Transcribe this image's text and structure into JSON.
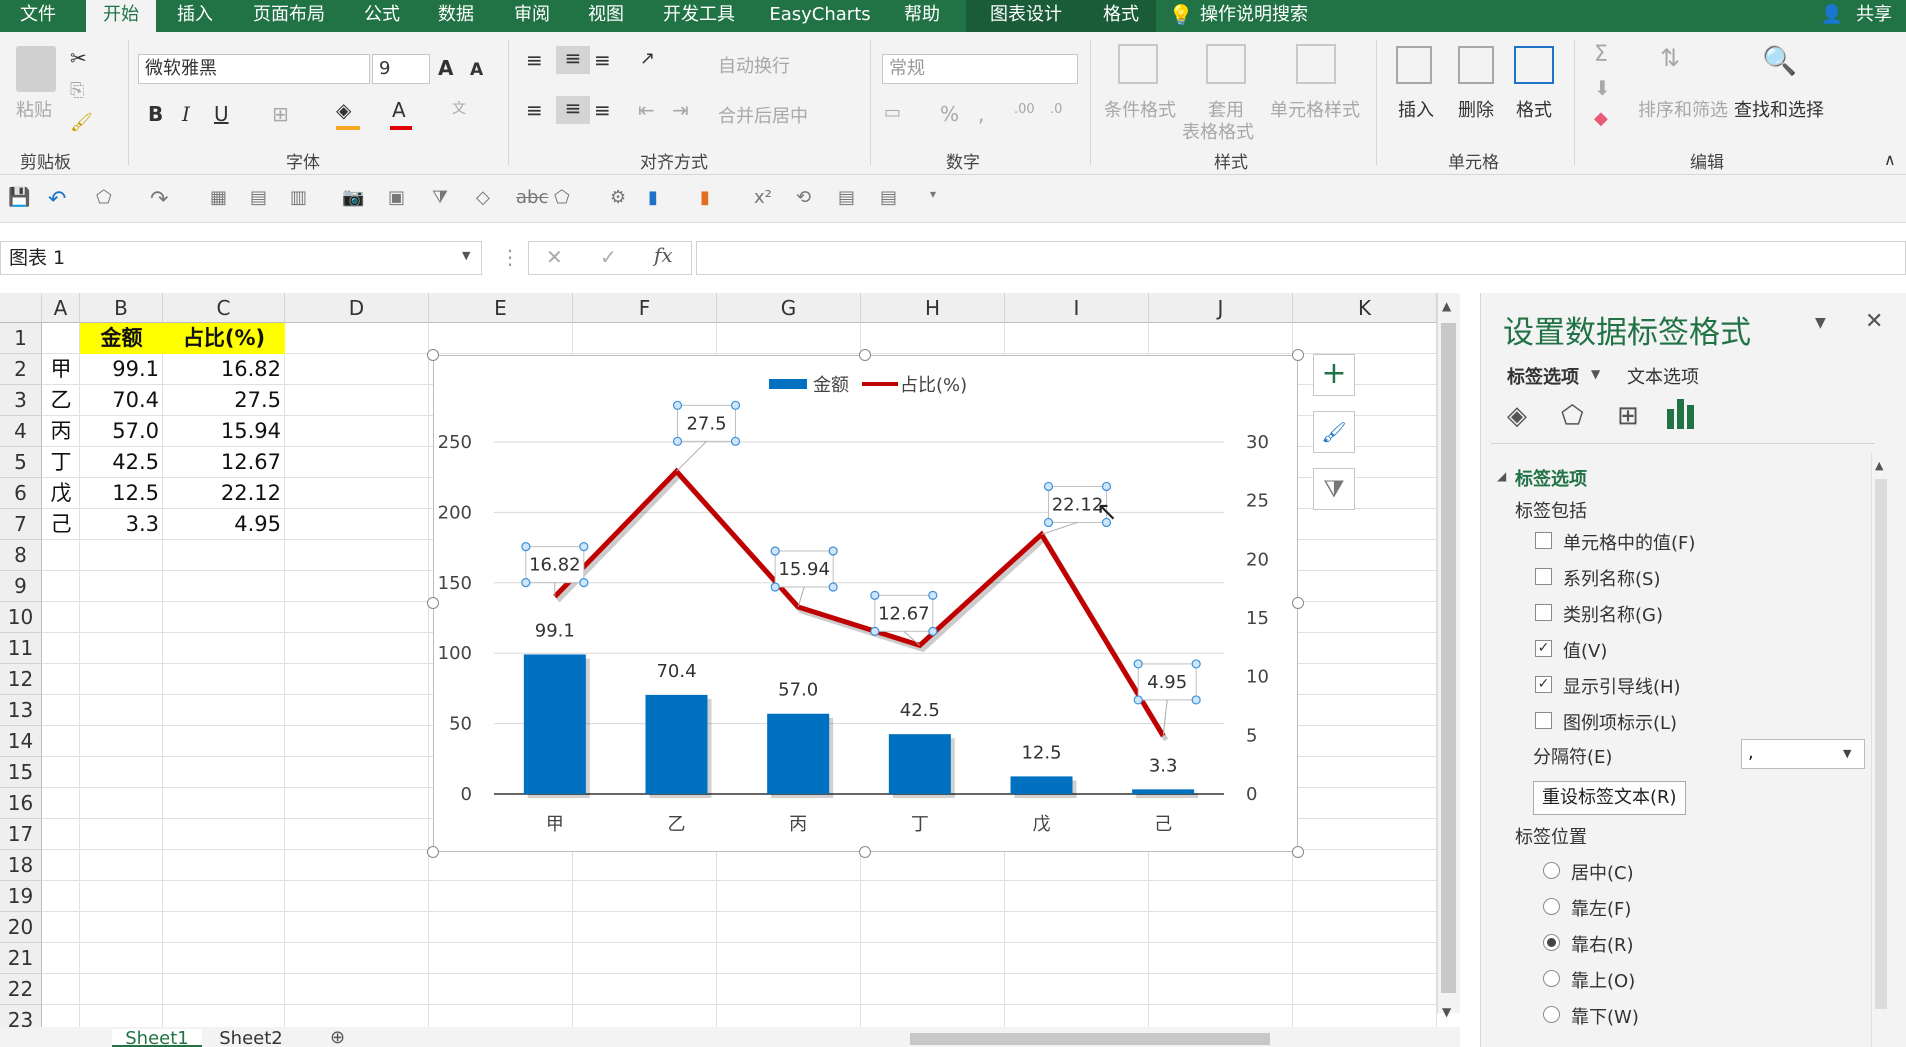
{
  "tabs": [
    "文件",
    "开始",
    "插入",
    "页面布局",
    "公式",
    "数据",
    "审阅",
    "视图",
    "开发工具",
    "EasyCharts",
    "帮助",
    "图表设计",
    "格式"
  ],
  "tell_me": "操作说明搜索",
  "share": "共享",
  "ribbon": {
    "paste": "粘贴",
    "font_name": "微软雅黑",
    "font_size": "9",
    "wrap_text": "自动换行",
    "merge_center": "合并后居中",
    "number_format": "常规",
    "cond_format": "条件格式",
    "table_format_1": "套用",
    "table_format_2": "表格格式",
    "cell_style": "单元格样式",
    "insert": "插入",
    "delete": "删除",
    "format": "格式",
    "sort_filter": "排序和筛选",
    "find_select": "查找和选择",
    "groups": [
      "剪贴板",
      "字体",
      "对齐方式",
      "数字",
      "样式",
      "单元格",
      "编辑"
    ]
  },
  "name_box": "图表 1",
  "columns": [
    "A",
    "B",
    "C",
    "D",
    "E",
    "F",
    "G",
    "H",
    "I",
    "J",
    "K"
  ],
  "rows": [
    "1",
    "2",
    "3",
    "4",
    "5",
    "6",
    "7",
    "8",
    "9",
    "10",
    "11",
    "12",
    "13",
    "14",
    "15",
    "16",
    "17",
    "18",
    "19",
    "20",
    "21",
    "22",
    "23"
  ],
  "table": {
    "header": [
      "",
      "金额",
      "占比(%)"
    ],
    "body": [
      [
        "甲",
        "99.1",
        "16.82"
      ],
      [
        "乙",
        "70.4",
        "27.5"
      ],
      [
        "丙",
        "57.0",
        "15.94"
      ],
      [
        "丁",
        "42.5",
        "12.67"
      ],
      [
        "戊",
        "12.5",
        "22.12"
      ],
      [
        "己",
        "3.3",
        "4.95"
      ]
    ]
  },
  "chart_data": {
    "type": "bar",
    "categories": [
      "甲",
      "乙",
      "丙",
      "丁",
      "戊",
      "己"
    ],
    "series": [
      {
        "name": "金额",
        "type": "bar",
        "values": [
          99.1,
          70.4,
          57.0,
          42.5,
          12.5,
          3.3
        ],
        "labels": [
          "99.1",
          "70.4",
          "57.0",
          "42.5",
          "12.5",
          "3.3"
        ],
        "color": "#0070c0",
        "axis": "left"
      },
      {
        "name": "占比(%)",
        "type": "line",
        "values": [
          16.82,
          27.5,
          15.94,
          12.67,
          22.12,
          4.95
        ],
        "labels": [
          "16.82",
          "27.5",
          "15.94",
          "12.67",
          "22.12",
          "4.95"
        ],
        "color": "#c00000",
        "axis": "right"
      }
    ],
    "y_left_ticks": [
      "0",
      "50",
      "100",
      "150",
      "200",
      "250"
    ],
    "y_right_ticks": [
      "0",
      "5",
      "10",
      "15",
      "20",
      "25",
      "30"
    ],
    "ylim_left": [
      0,
      250
    ],
    "ylim_right": [
      0,
      30
    ],
    "legend": "top",
    "grid": true
  },
  "pane": {
    "title": "设置数据标签格式",
    "tab_label_options": "标签选项",
    "tab_text_options": "文本选项",
    "section": "标签选项",
    "includes": "标签包括",
    "options": [
      {
        "label": "单元格中的值(F)",
        "checked": false
      },
      {
        "label": "系列名称(S)",
        "checked": false
      },
      {
        "label": "类别名称(G)",
        "checked": false
      },
      {
        "label": "值(V)",
        "checked": true
      },
      {
        "label": "显示引导线(H)",
        "checked": true
      },
      {
        "label": "图例项标示(L)",
        "checked": false
      }
    ],
    "separator_label": "分隔符(E)",
    "separator_value": ",",
    "reset_label": "重设标签文本(R)",
    "position_label": "标签位置",
    "positions": [
      {
        "label": "居中(C)",
        "selected": false
      },
      {
        "label": "靠左(F)",
        "selected": false
      },
      {
        "label": "靠右(R)",
        "selected": true
      },
      {
        "label": "靠上(O)",
        "selected": false
      },
      {
        "label": "靠下(W)",
        "selected": false
      }
    ]
  },
  "sheets": [
    "Sheet1",
    "Sheet2"
  ]
}
